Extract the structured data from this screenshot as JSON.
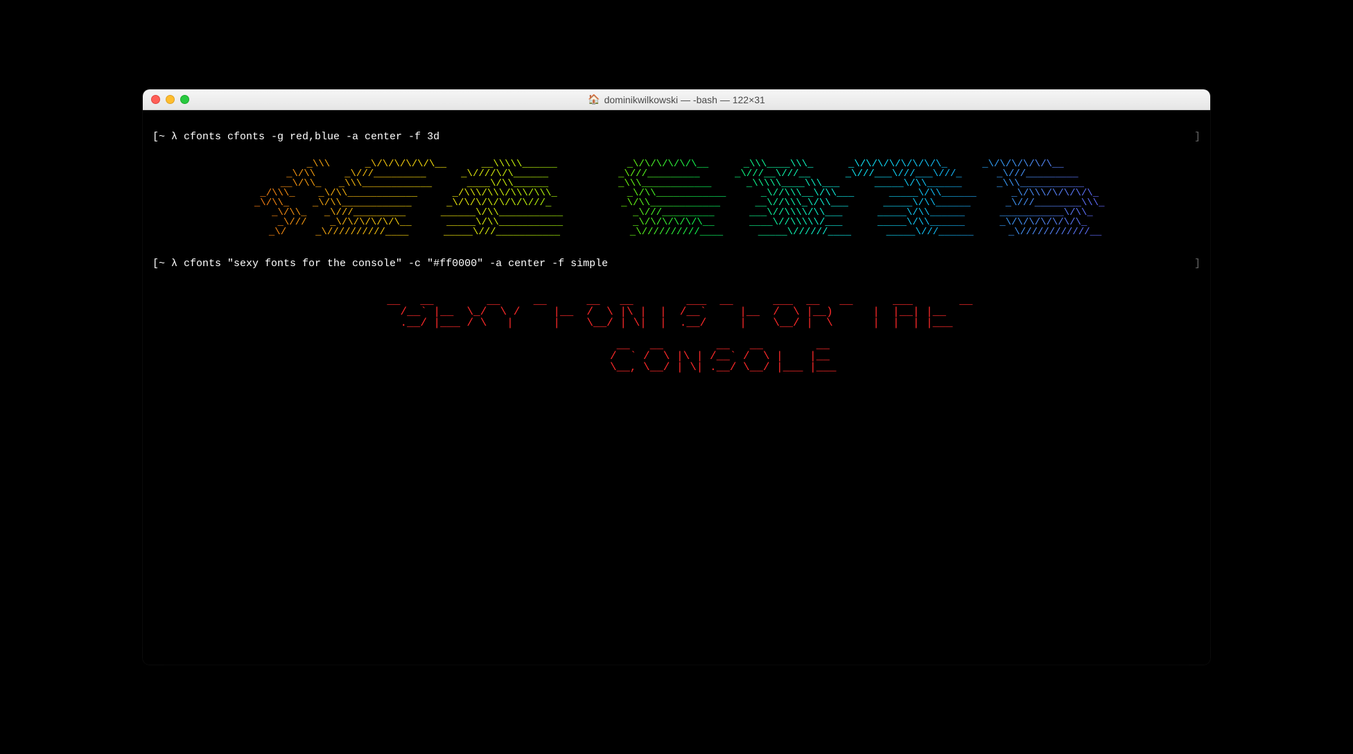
{
  "window": {
    "title": "dominikwilkowski — -bash — 122×31",
    "home_icon": "🏠"
  },
  "prompts": {
    "p1_left": "[~ λ cfonts cfonts -g red,blue -a center -f 3d",
    "p1_right": "]",
    "p2_left": "[~ λ cfonts \"sexy fonts for the console\" -c \"#ff0000\" -a center -f simple",
    "p2_right": "]"
  },
  "ascii_3d": "    _\\\\\\      _\\/\\/\\/\\/\\/\\__      __\\\\\\\\\\______            _\\/\\/\\/\\/\\/\\__      _\\\\\\____\\\\\\_      _\\/\\/\\/\\/\\/\\/\\/\\_      _\\/\\/\\/\\/\\/\\__ \n   _\\/\\\\     _\\///_________      _\\////\\/\\______            _\\///_________      _\\///__\\///__      _\\///___\\///___\\///_      _\\///_________ \n  __\\/\\\\_   _\\\\\\____________      ____\\/\\\\______            _\\\\\\____________      _\\\\\\\\\\____\\\\\\___      _____\\/\\\\______      _\\\\\\___________\n _/\\\\\\_    _\\/\\\\____________      _/\\\\\\/\\\\\\/\\\\\\/\\\\\\_            _\\/\\\\____________      _\\//\\\\\\__\\/\\\\___      _____\\/\\\\______      _\\/\\\\\\/\\/\\/\\/\\_\n _\\/\\\\_    _\\/\\\\____________      _\\/\\/\\/\\/\\/\\/\\///_            _\\/\\\\____________      __\\//\\\\\\_\\/\\\\___      _____\\/\\\\______      _\\///________\\\\\\_\n  _\\/\\\\_   _\\///_________      ______\\/\\\\___________            _\\///_________      ___\\//\\\\\\\\/\\\\___      _____\\/\\\\______      ___________\\/\\\\_\n   _\\///    _\\/\\/\\/\\/\\/\\__      _____\\/\\\\___________            _\\/\\/\\/\\/\\/\\__      ____\\//\\\\\\\\\\/___      _____\\/\\\\______      _\\/\\/\\/\\/\\/\\/\\_ \n    _\\/     _\\//////////____      _____\\///___________            _\\//////////____      _____\\//////____      _____\\///______      _\\////////////__ ",
  "ascii_simple": "  __   __        __     __      __   __        ___  __      ___  __   __      ___       __ \n /__` |__  \\_/  \\ /     |__  /  \\ |\\ |  |  /__`     |__  /  \\ |__)      |  |__| |__  \n .__/ |___ / \\   |      |    \\__/ | \\|  |  .__/     |    \\__/ |  \\      |  |  | |___ \n                                                                                                   \n                __   __        __   __        __  \n               /  ` /  \\ |\\ | /__` /  \\ |    |__  \n               \\__, \\__/ | \\| .__/ \\__/ |___ |___ "
}
